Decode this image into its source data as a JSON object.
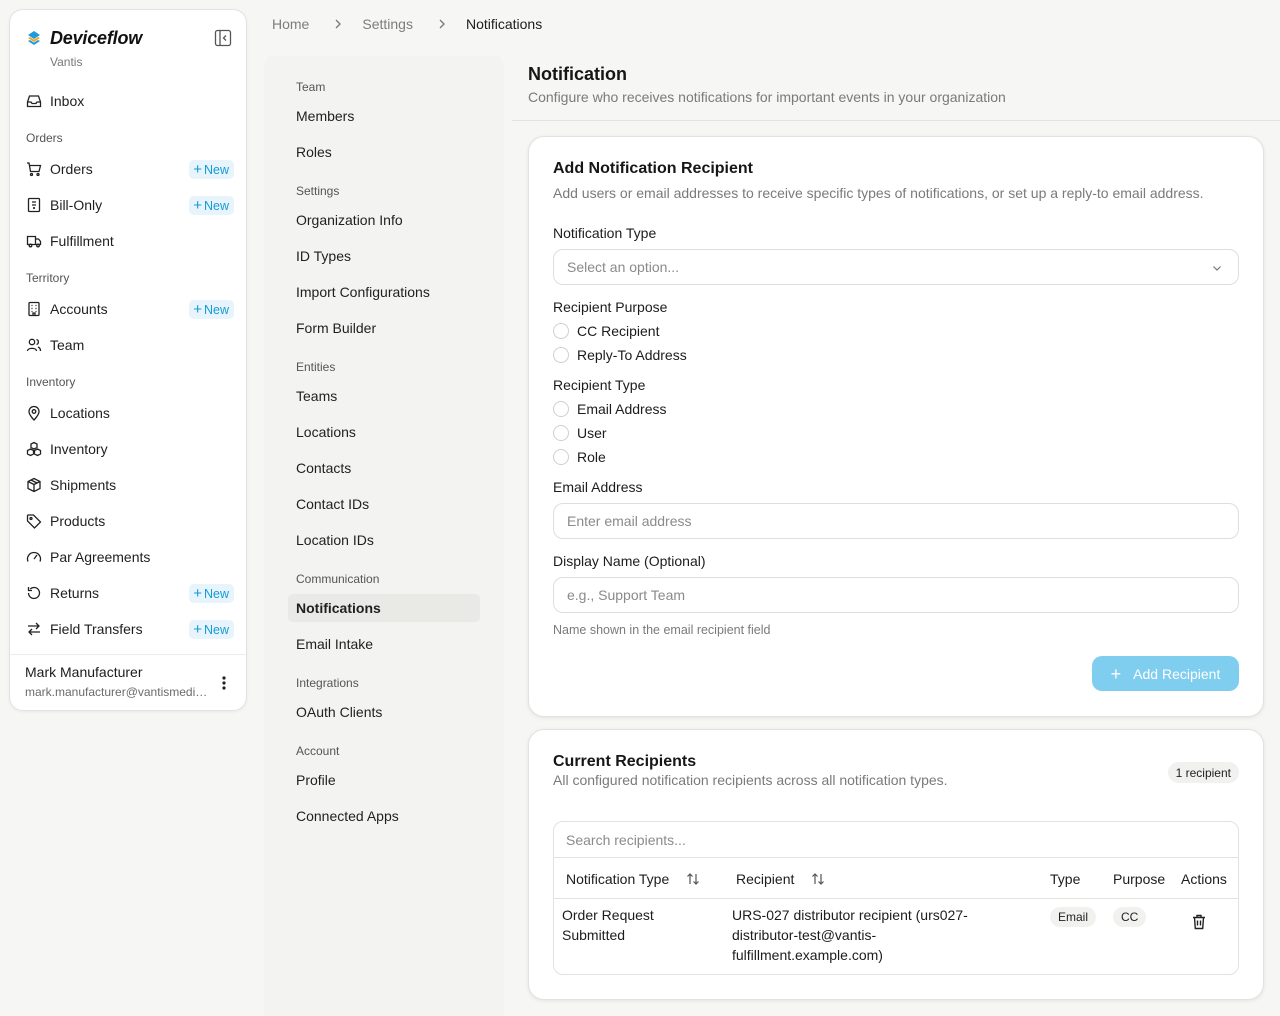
{
  "app": {
    "name": "Deviceflow",
    "org": "Vantis"
  },
  "colors": {
    "accent": "#159bd7",
    "accent_light": "#e7f4fb",
    "button_disabled": "#7fcdef"
  },
  "sidebar": {
    "new_label": "New",
    "inbox": {
      "label": "Inbox",
      "icon": "inbox-icon"
    },
    "sections": [
      "Orders",
      "Territory",
      "Inventory"
    ],
    "orders_items": [
      {
        "label": "Orders",
        "icon": "cart-icon",
        "new": true
      },
      {
        "label": "Bill-Only",
        "icon": "receipt-icon",
        "new": true
      },
      {
        "label": "Fulfillment",
        "icon": "truck-icon",
        "new": false
      }
    ],
    "territory_items": [
      {
        "label": "Accounts",
        "icon": "building-icon",
        "new": true
      },
      {
        "label": "Team",
        "icon": "users-icon",
        "new": false
      }
    ],
    "inventory_items": [
      {
        "label": "Locations",
        "icon": "map-pin-icon",
        "new": false
      },
      {
        "label": "Inventory",
        "icon": "boxes-icon",
        "new": false
      },
      {
        "label": "Shipments",
        "icon": "package-icon",
        "new": false
      },
      {
        "label": "Products",
        "icon": "tag-icon",
        "new": false
      },
      {
        "label": "Par Agreements",
        "icon": "gauge-icon",
        "new": false
      },
      {
        "label": "Returns",
        "icon": "rotate-ccw-icon",
        "new": true
      },
      {
        "label": "Field Transfers",
        "icon": "arrows-transfer-icon",
        "new": true
      }
    ],
    "user": {
      "name": "Mark Manufacturer",
      "email": "mark.manufacturer@vantismedical.com"
    }
  },
  "breadcrumb": [
    "Home",
    "Settings",
    "Notifications"
  ],
  "settings_nav": {
    "sections": [
      {
        "title": "Team",
        "items": [
          "Members",
          "Roles"
        ]
      },
      {
        "title": "Settings",
        "items": [
          "Organization Info",
          "ID Types",
          "Import Configurations",
          "Form Builder"
        ]
      },
      {
        "title": "Entities",
        "items": [
          "Teams",
          "Locations",
          "Contacts",
          "Contact IDs",
          "Location IDs"
        ]
      },
      {
        "title": "Communication",
        "items": [
          "Notifications",
          "Email Intake"
        ]
      },
      {
        "title": "Integrations",
        "items": [
          "OAuth Clients"
        ]
      },
      {
        "title": "Account",
        "items": [
          "Profile",
          "Connected Apps"
        ]
      }
    ],
    "active": "Notifications"
  },
  "page": {
    "title": "Notification",
    "subtitle": "Configure who receives notifications for important events in your organization"
  },
  "add_form": {
    "title": "Add Notification Recipient",
    "description": "Add users or email addresses to receive specific types of notifications, or set up a reply-to email address.",
    "notification_type_label": "Notification Type",
    "notification_type_placeholder": "Select an option...",
    "purpose_label": "Recipient Purpose",
    "purpose_options": [
      "CC Recipient",
      "Reply-To Address"
    ],
    "type_label": "Recipient Type",
    "type_options": [
      "Email Address",
      "User",
      "Role"
    ],
    "email_label": "Email Address",
    "email_placeholder": "Enter email address",
    "display_name_label": "Display Name (Optional)",
    "display_name_placeholder": "e.g., Support Team",
    "display_name_hint": "Name shown in the email recipient field",
    "submit_label": "Add Recipient"
  },
  "current": {
    "title": "Current Recipients",
    "description": "All configured notification recipients across all notification types.",
    "count_label": "1 recipient",
    "search_placeholder": "Search recipients...",
    "columns": [
      "Notification Type",
      "Recipient",
      "Type",
      "Purpose",
      "Actions"
    ],
    "rows": [
      {
        "notification_type_lines": [
          "Order Request",
          "Submitted"
        ],
        "recipient_lines": [
          "URS-027 distributor recipient (urs027-",
          "distributor-test@vantis-",
          "fulfillment.example.com)"
        ],
        "type": "Email",
        "purpose": "CC"
      }
    ]
  }
}
